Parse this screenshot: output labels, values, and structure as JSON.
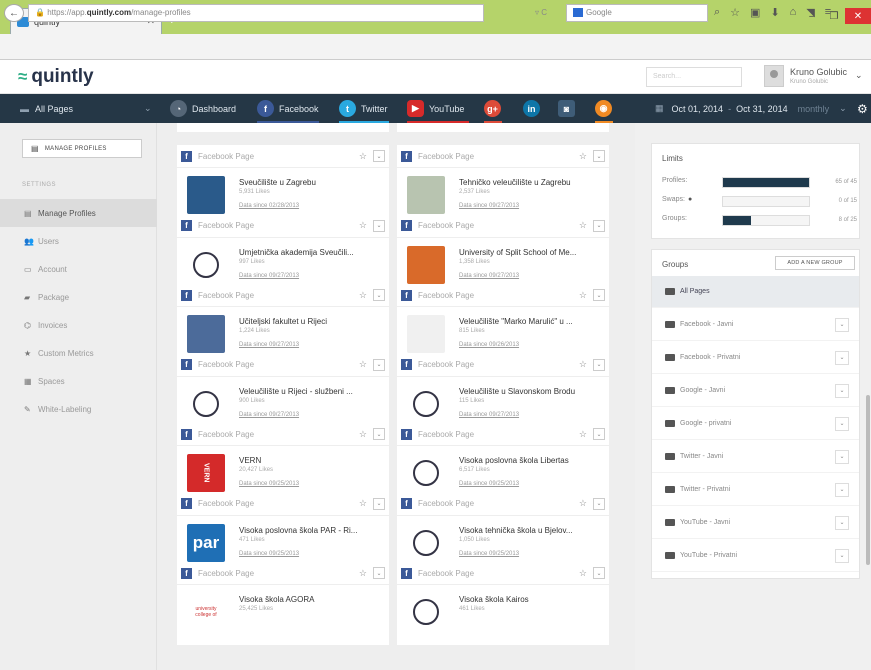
{
  "browser": {
    "tab_title": "quintly",
    "url_prefix": "https://app.",
    "url_domain": "quintly.com",
    "url_path": "/manage-profiles",
    "search_placeholder": "Google"
  },
  "app": {
    "logo_text": "quintly",
    "search_placeholder": "Search...",
    "user_name": "Kruno Golubic",
    "user_sub": "Kruno Golubic"
  },
  "nav": {
    "all_pages": "All Pages",
    "dashboard": "Dashboard",
    "facebook": "Facebook",
    "twitter": "Twitter",
    "youtube": "YouTube",
    "date_from": "Oct 01, 2014",
    "date_sep": "-",
    "date_to": "Oct 31, 2014",
    "interval": "monthly"
  },
  "sidebar": {
    "manage_button": "MANAGE PROFILES",
    "section_label": "SETTINGS",
    "items": [
      {
        "label": "Manage Profiles",
        "icon": "profiles-icon"
      },
      {
        "label": "Users",
        "icon": "users-icon"
      },
      {
        "label": "Account",
        "icon": "account-icon"
      },
      {
        "label": "Package",
        "icon": "package-icon"
      },
      {
        "label": "Invoices",
        "icon": "invoices-icon"
      },
      {
        "label": "Custom Metrics",
        "icon": "star-icon"
      },
      {
        "label": "Spaces",
        "icon": "spaces-icon"
      },
      {
        "label": "White-Labeling",
        "icon": "pencil-icon"
      }
    ]
  },
  "cards": [
    {
      "type": "Facebook Page",
      "name": "Sveučilište u Zagrebu",
      "likes": "5,931 Likes",
      "date": "Data since 02/28/2013",
      "color": "#2a5a8a"
    },
    {
      "type": "Facebook Page",
      "name": "Tehničko veleučilište u Zagrebu",
      "likes": "2,537 Likes",
      "date": "Data since 09/27/2013",
      "color": "#b8c4b0"
    },
    {
      "type": "Facebook Page",
      "name": "Umjetnička akademija Sveučili...",
      "likes": "997 Likes",
      "date": "Data since 09/27/2013",
      "color": "#ffffff"
    },
    {
      "type": "Facebook Page",
      "name": "University of Split School of Me...",
      "likes": "1,358 Likes",
      "date": "Data since 09/27/2013",
      "color": "#d96a2a"
    },
    {
      "type": "Facebook Page",
      "name": "Učiteljski fakultet u Rijeci",
      "likes": "1,224 Likes",
      "date": "Data since 09/27/2013",
      "color": "#4c6b9a"
    },
    {
      "type": "Facebook Page",
      "name": "Veleučilište \"Marko Marulić\" u ...",
      "likes": "815 Likes",
      "date": "Data since 09/26/2013",
      "color": "#f0f0f0"
    },
    {
      "type": "Facebook Page",
      "name": "Veleučilište u Rijeci - službeni ...",
      "likes": "900 Likes",
      "date": "Data since 09/27/2013",
      "color": "#ffffff"
    },
    {
      "type": "Facebook Page",
      "name": "Veleučilište u Slavonskom Brodu",
      "likes": "115 Likes",
      "date": "Data since 09/27/2013",
      "color": "#ffffff"
    },
    {
      "type": "Facebook Page",
      "name": "VERN",
      "likes": "20,427 Likes",
      "date": "Data since 09/25/2013",
      "color": "#d42a2a"
    },
    {
      "type": "Facebook Page",
      "name": "Visoka poslovna škola Libertas",
      "likes": "6,517 Likes",
      "date": "Data since 09/25/2013",
      "color": "#ffffff"
    },
    {
      "type": "Facebook Page",
      "name": "Visoka poslovna škola PAR - Ri...",
      "likes": "471 Likes",
      "date": "Data since 09/25/2013",
      "color": "#1f6fb5"
    },
    {
      "type": "Facebook Page",
      "name": "Visoka tehnička škola u Bjelov...",
      "likes": "1,050 Likes",
      "date": "Data since 09/25/2013",
      "color": "#ffffff"
    },
    {
      "type": "Facebook Page",
      "name": "Visoka škola AGORA",
      "likes": "25,425 Likes",
      "date": "",
      "color": "#ffffff"
    },
    {
      "type": "Facebook Page",
      "name": "Visoka škola Kairos",
      "likes": "461 Likes",
      "date": "",
      "color": "#ffffff"
    }
  ],
  "thumb_texts": {
    "vern": "VERN",
    "par": "par",
    "agora": "university college of"
  },
  "limits": {
    "title": "Limits",
    "rows": [
      {
        "label": "Profiles:",
        "value": "65 of 45",
        "fill": 1.0
      },
      {
        "label": "Swaps:",
        "value": "0 of 15",
        "fill": 0.0
      },
      {
        "label": "Groups:",
        "value": "8 of 25",
        "fill": 0.32
      }
    ]
  },
  "groups": {
    "title": "Groups",
    "add_button": "ADD A NEW GROUP",
    "items": [
      "All Pages",
      "Facebook - Javni",
      "Facebook - Privatni",
      "Google - Javni",
      "Google - privatni",
      "Twitter - Javni",
      "Twitter - Privatni",
      "YouTube - Javni",
      "YouTube - Privatni"
    ]
  }
}
